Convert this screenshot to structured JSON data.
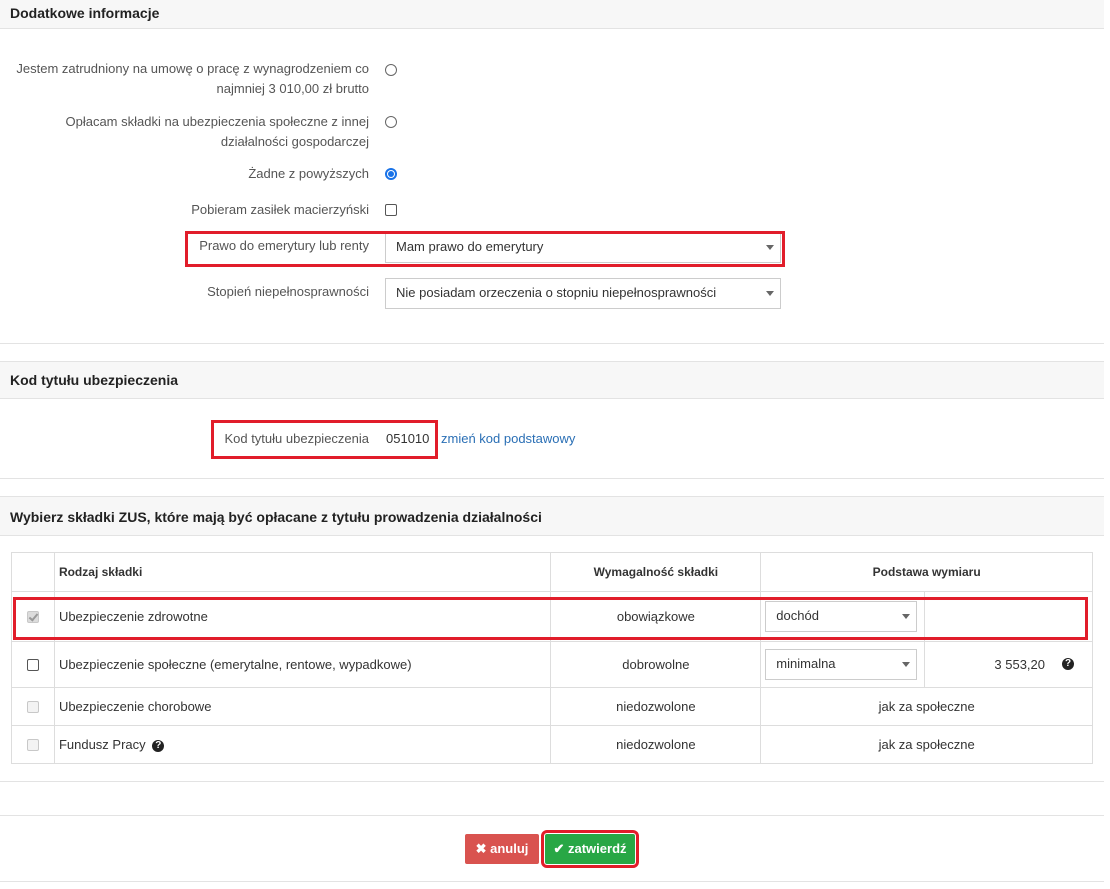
{
  "section_additional": {
    "title": "Dodatkowe informacje",
    "option1_line1": "Jestem zatrudniony na umowę o pracę z wynagrodzeniem co",
    "option1_line2": "najmniej 3 010,00 zł brutto",
    "option2_line1": "Opłacam składki na ubezpieczenia społeczne z innej",
    "option2_line2": "działalności gospodarczej",
    "option3": "Żadne z powyższych",
    "maternity_label": "Pobieram zasiłek macierzyński",
    "pension_label": "Prawo do emerytury lub renty",
    "pension_value": "Mam prawo do emerytury",
    "disability_label": "Stopień niepełnosprawności",
    "disability_value": "Nie posiadam orzeczenia o stopniu niepełnosprawności"
  },
  "section_code": {
    "title": "Kod tytułu ubezpieczenia",
    "label": "Kod tytułu ubezpieczenia",
    "value": "051010",
    "change_link": "zmień kod podstawowy"
  },
  "section_zus": {
    "title": "Wybierz składki ZUS, które mają być opłacane z tytułu prowadzenia działalności",
    "col_type": "Rodzaj składki",
    "col_requirement": "Wymagalność składki",
    "col_base": "Podstawa wymiaru",
    "rows": [
      {
        "name": "Ubezpieczenie zdrowotne",
        "requirement": "obowiązkowe",
        "base_select": "dochód",
        "amount": ""
      },
      {
        "name": "Ubezpieczenie społeczne (emerytalne, rentowe, wypadkowe)",
        "requirement": "dobrowolne",
        "base_select": "minimalna",
        "amount": "3 553,20"
      },
      {
        "name": "Ubezpieczenie chorobowe",
        "requirement": "niedozwolone",
        "base_text": "jak za społeczne"
      },
      {
        "name": "Fundusz Pracy",
        "requirement": "niedozwolone",
        "base_text": "jak za społeczne"
      }
    ]
  },
  "buttons": {
    "cancel": "anuluj",
    "confirm": "zatwierdź"
  },
  "colors": {
    "highlight": "#e11d2a",
    "cancel": "#d9534f",
    "confirm": "#28a745",
    "radio_selected": "#1a73e8"
  }
}
